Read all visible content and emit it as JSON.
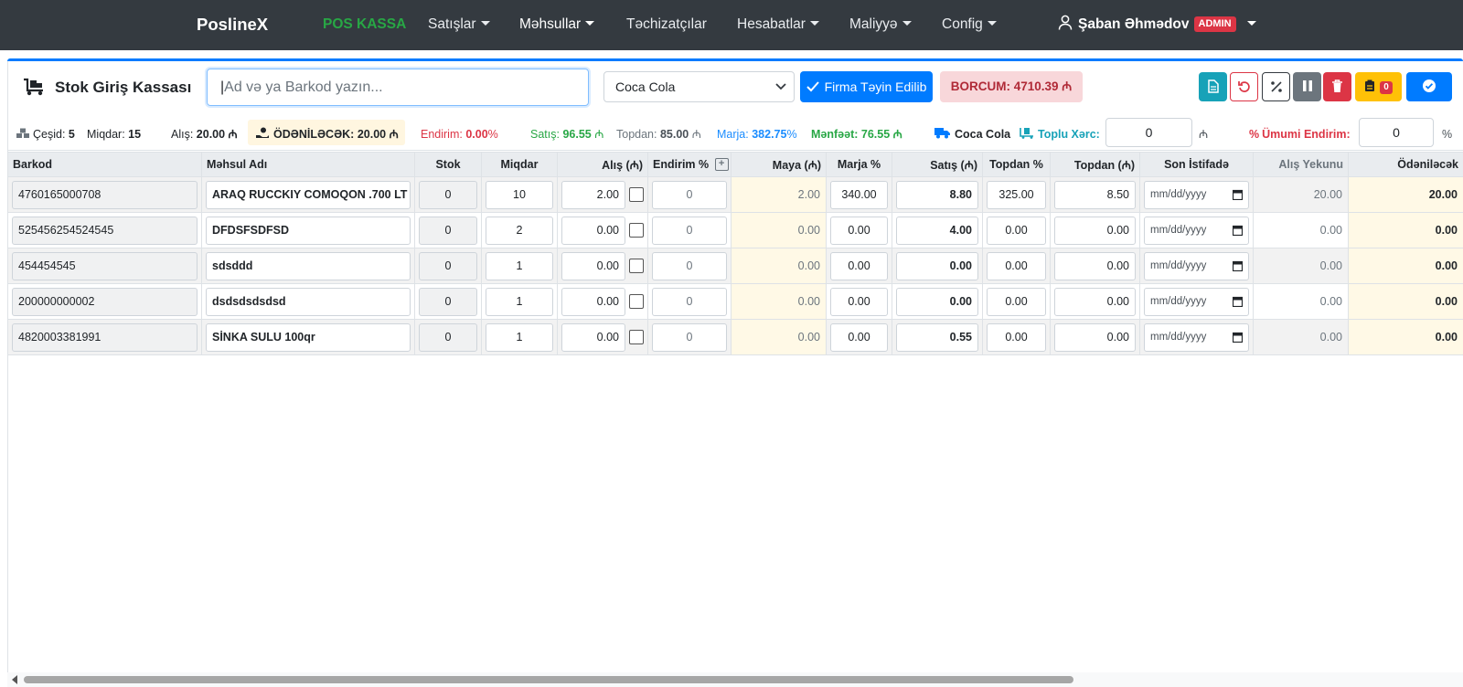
{
  "nav": {
    "brand": "PoslineX",
    "pos_kassa": "POS KASSA",
    "satislar": "Satışlar",
    "mehsullar": "Məhsullar",
    "techizatcilar": "Təchizatçılar",
    "hesabatlar": "Hesabatlar",
    "maliyye": "Maliyyə",
    "config": "Config",
    "user": "Şaban Əhmədov",
    "role": "ADMIN"
  },
  "toolbar": {
    "title": "Stok Giriş Kassası",
    "search_placeholder": "Ad və ya Barkod yazın...",
    "supplier": "Coca Cola",
    "firma_btn": "Firma Təyin Edilib",
    "borcum": "BORCUM: 4710.39 ₼",
    "badge_count": "0"
  },
  "stats": {
    "cesid_label": "Çeşid:",
    "cesid": "5",
    "miqdar_label": "Miqdar:",
    "miqdar": "15",
    "alis_label": "Alış:",
    "alis": "20.00 ₼",
    "odenilecek_label": "ÖDƏNİLƏCƏK:",
    "odenilecek": "20.00 ₼",
    "endirim_label": "Endirim:",
    "endirim": "0.00",
    "pct": "%",
    "satis_label": "Satış:",
    "satis": "96.55",
    "currency": "₼",
    "topdan_label": "Topdan:",
    "topdan": "85.00",
    "marja_label": "Marja:",
    "marja": "382.75",
    "menfeet_label": "Mənfəət:",
    "menfeet": "76.55 ₼",
    "firma": "Coca Cola",
    "toplu_label": "Toplu Xərc:",
    "toplu_value": "0",
    "umumi_label": "Ümumi Endirim:",
    "umumi_value": "0",
    "umumi_unit": "%"
  },
  "columns": {
    "barkod": "Barkod",
    "ad": "Məhsul Adı",
    "stok": "Stok",
    "miqdar": "Miqdar",
    "alis": "Alış (₼)",
    "endirim": "Endirim %",
    "maya": "Maya (₼)",
    "marja": "Marja %",
    "satis": "Satış (₼)",
    "topdan_pct": "Topdan %",
    "topdan": "Topdan (₼)",
    "son": "Son İstifadə",
    "alis_yekunu": "Alış Yekunu",
    "odenilecek": "Ödəniləcək"
  },
  "rows": [
    {
      "barkod": "4760165000708",
      "ad": "ARAQ RUCCKIY COMOQON .700 LT",
      "stok": "0",
      "miqdar": "10",
      "alis": "2.00",
      "endirim": "0",
      "maya": "2.00",
      "marja": "340.00",
      "satis": "8.80",
      "topdan_pct": "325.00",
      "topdan": "8.50",
      "son": "mm/dd/yyyy",
      "yekun": "20.00",
      "odn": "20.00"
    },
    {
      "barkod": "525456254524545",
      "ad": "DFDSFSDFSD",
      "stok": "0",
      "miqdar": "2",
      "alis": "0.00",
      "endirim": "0",
      "maya": "0.00",
      "marja": "0.00",
      "satis": "4.00",
      "topdan_pct": "0.00",
      "topdan": "0.00",
      "son": "mm/dd/yyyy",
      "yekun": "0.00",
      "odn": "0.00"
    },
    {
      "barkod": "454454545",
      "ad": "sdsddd",
      "stok": "0",
      "miqdar": "1",
      "alis": "0.00",
      "endirim": "0",
      "maya": "0.00",
      "marja": "0.00",
      "satis": "0.00",
      "topdan_pct": "0.00",
      "topdan": "0.00",
      "son": "mm/dd/yyyy",
      "yekun": "0.00",
      "odn": "0.00"
    },
    {
      "barkod": "200000000002",
      "ad": "dsdsdsdsdsd",
      "stok": "0",
      "miqdar": "1",
      "alis": "0.00",
      "endirim": "0",
      "maya": "0.00",
      "marja": "0.00",
      "satis": "0.00",
      "topdan_pct": "0.00",
      "topdan": "0.00",
      "son": "mm/dd/yyyy",
      "yekun": "0.00",
      "odn": "0.00"
    },
    {
      "barkod": "4820003381991",
      "ad": "SİNKA SULU 100qr",
      "stok": "0",
      "miqdar": "1",
      "alis": "0.00",
      "endirim": "0",
      "maya": "0.00",
      "marja": "0.00",
      "satis": "0.55",
      "topdan_pct": "0.00",
      "topdan": "0.00",
      "son": "mm/dd/yyyy",
      "yekun": "0.00",
      "odn": "0.00"
    }
  ],
  "icons": {
    "cart": "dolly-icon",
    "doc": "file-icon",
    "reset": "undo-icon",
    "percent": "percent-icon",
    "pause": "pause-icon",
    "trash": "trash-icon",
    "clipboard": "clipboard-icon",
    "check": "check-circle-icon",
    "truck": "truck-icon",
    "hand": "hand-money-icon",
    "boxes": "boxes-icon"
  },
  "colors": {
    "nav": "#343a40",
    "primary": "#007bff",
    "success": "#28a745",
    "danger": "#dc3545",
    "info": "#17a2b8",
    "warning": "#ffc107",
    "secondary": "#6c757d"
  }
}
